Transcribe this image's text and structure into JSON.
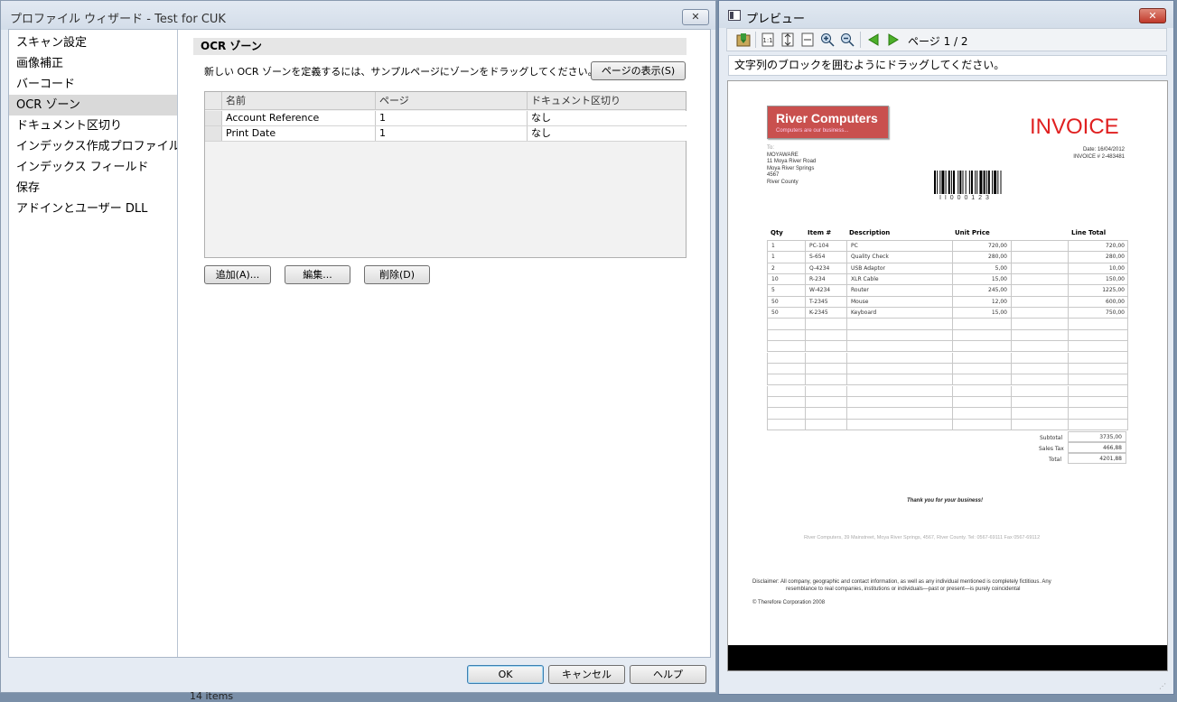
{
  "wizard": {
    "title": "プロファイル ウィザード - Test for CUK",
    "close_label": "✕",
    "nav": [
      "スキャン設定",
      "画像補正",
      "バーコード",
      "OCR ゾーン",
      "ドキュメント区切り",
      "インデックス作成プロファイル",
      "インデックス フィールド",
      "保存",
      "アドインとユーザー DLL"
    ],
    "active_nav": 3,
    "section_title": "OCR ゾーン",
    "instruction": "新しい OCR ゾーンを定義するには、サンプルページにゾーンをドラッグしてください。",
    "show_page_button": "ページの表示(S)",
    "table": {
      "columns": [
        "名前",
        "ページ",
        "ドキュメント区切り"
      ],
      "rows": [
        [
          "Account Reference",
          "1",
          "なし"
        ],
        [
          "Print Date",
          "1",
          "なし"
        ]
      ]
    },
    "add_button": "追加(A)...",
    "edit_button": "編集...",
    "delete_button": "削除(D)",
    "ok_button": "OK",
    "cancel_button": "キャンセル",
    "help_button": "ヘルプ"
  },
  "preview": {
    "title": "プレビュー",
    "page_indicator": "ページ 1 / 2",
    "hint": "文字列のブロックを囲むようにドラッグしてください。",
    "toolbar_icons": [
      "save-icon",
      "actual-size-icon",
      "fit-page-icon",
      "fit-width-icon",
      "zoom-in-icon",
      "zoom-out-icon",
      "prev-page-icon",
      "next-page-icon"
    ]
  },
  "invoice": {
    "company": "River Computers",
    "tagline": "Computers are our business...",
    "doc_title": "INVOICE",
    "to_label": "To:",
    "address": [
      "MOYAWARE",
      "11 Moya River Road",
      "Moya River Springs",
      "4567",
      "River County"
    ],
    "date": "Date: 16/04/2012",
    "invoice_no": "INVOICE # 2-483481",
    "barcode_text": "I I 0 0 0 1 2 3",
    "headers": [
      "Qty",
      "Item #",
      "Description",
      "Unit Price",
      "Line Total"
    ],
    "items": [
      [
        "1",
        "PC-104",
        "PC",
        "720,00",
        "720,00"
      ],
      [
        "1",
        "S-654",
        "Quality Check",
        "280,00",
        "280,00"
      ],
      [
        "2",
        "Q-4234",
        "USB Adaptor",
        "5,00",
        "10,00"
      ],
      [
        "10",
        "R-234",
        "XLR Cable",
        "15,00",
        "150,00"
      ],
      [
        "5",
        "W-4234",
        "Router",
        "245,00",
        "1225,00"
      ],
      [
        "50",
        "T-2345",
        "Mouse",
        "12,00",
        "600,00"
      ],
      [
        "50",
        "K-2345",
        "Keyboard",
        "15,00",
        "750,00"
      ]
    ],
    "empty_rows": 10,
    "subtotal_label": "Subtotal",
    "subtotal": "3735,00",
    "tax_label": "Sales Tax",
    "tax": "466,88",
    "total_label": "Total",
    "total": "4201,88",
    "thanks": "Thank you for your business!",
    "footer": "River Computers, 39 Mainstreet, Moya River Springs, 4567, River County.  Tel: 0567-69111  Fax 0567-69112",
    "disclaimer_1": "Disclaimer: All company, geographic and contact information, as well as any individual mentioned is completely fictitious.  Any",
    "disclaimer_2": "resemblance to real companies, institutions or individuals—past or present—is purely coincidental",
    "copyright": "© Therefore Corporation 2008"
  },
  "behind_text": "14 items"
}
